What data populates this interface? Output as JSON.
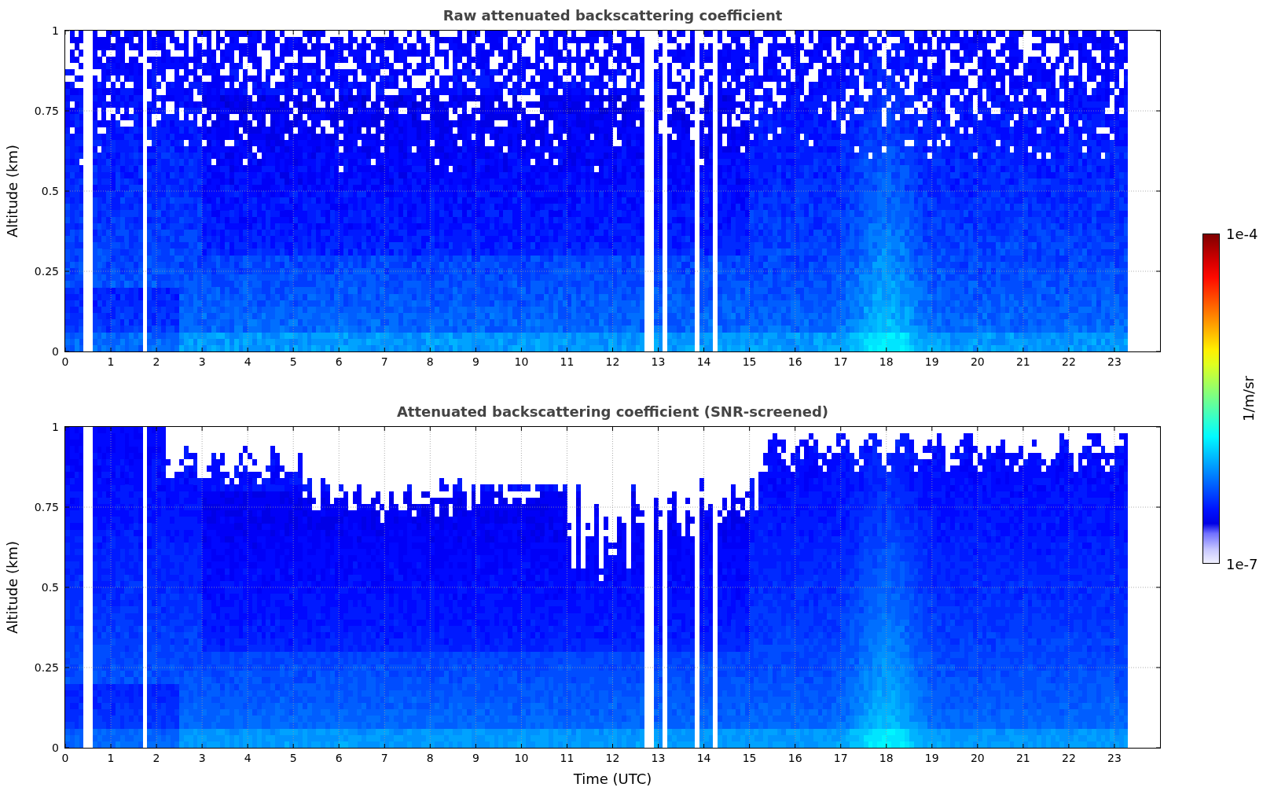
{
  "panels": [
    {
      "kind": "raw",
      "title": "Raw attenuated backscattering coefficient",
      "ylabel": "Altitude (km)",
      "yticks": [
        "1",
        "0.75",
        "0.5",
        "0.25",
        "0"
      ],
      "xticks": [
        "0",
        "1",
        "2",
        "3",
        "4",
        "5",
        "6",
        "7",
        "8",
        "9",
        "10",
        "11",
        "12",
        "13",
        "14",
        "15",
        "16",
        "17",
        "18",
        "19",
        "20",
        "21",
        "22",
        "23"
      ]
    },
    {
      "kind": "screened",
      "title": "Attenuated backscattering coefficient (SNR-screened)",
      "ylabel": "Altitude (km)",
      "yticks": [
        "1",
        "0.75",
        "0.5",
        "0.25",
        "0"
      ],
      "xticks": [
        "0",
        "1",
        "2",
        "3",
        "4",
        "5",
        "6",
        "7",
        "8",
        "9",
        "10",
        "11",
        "12",
        "13",
        "14",
        "15",
        "16",
        "17",
        "18",
        "19",
        "20",
        "21",
        "22",
        "23"
      ],
      "xlabel": "Time (UTC)"
    }
  ],
  "colorbar": {
    "label": "1/m/sr",
    "max_label": "1e-4",
    "min_label": "1e-7"
  }
}
